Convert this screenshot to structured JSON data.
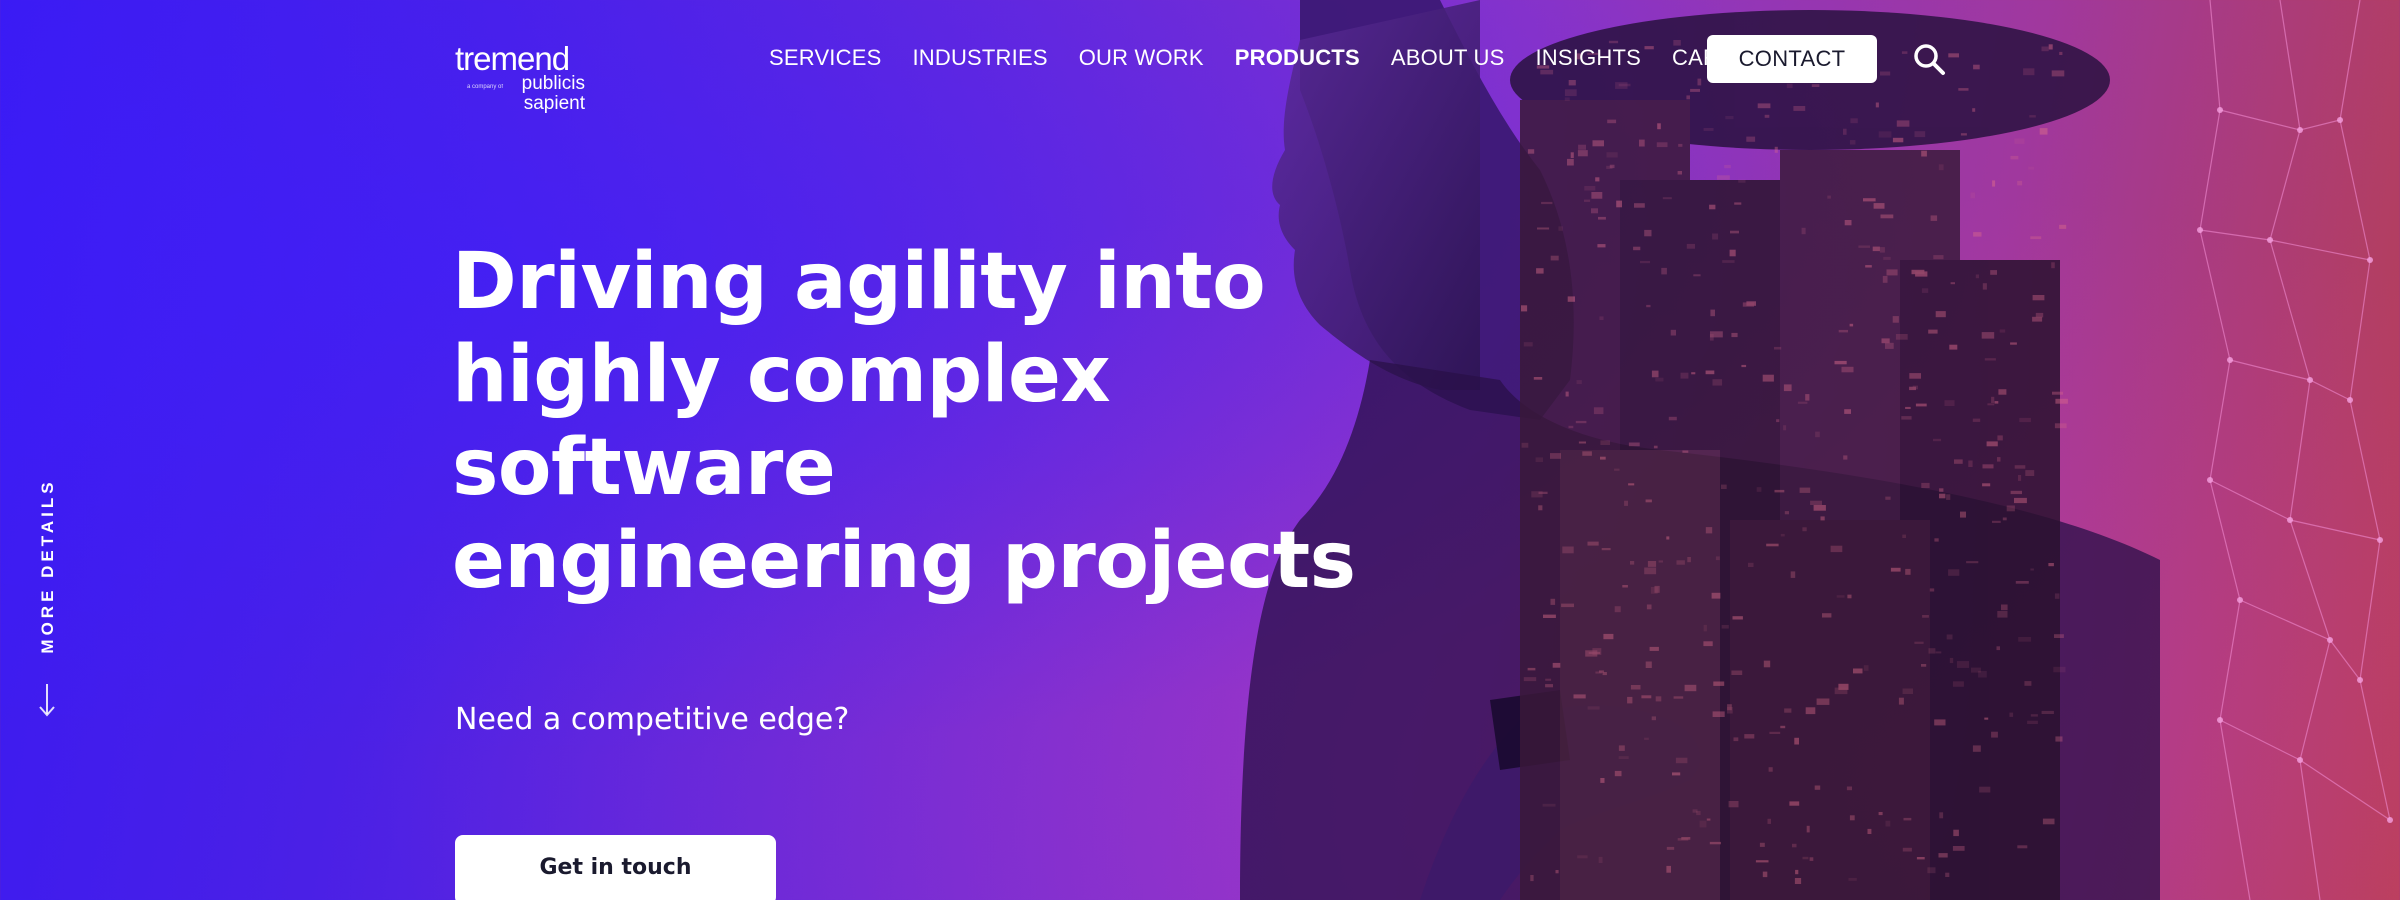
{
  "logo": {
    "brand": "tremend",
    "tiny": "a company of",
    "sub_line1": "publicis",
    "sub_line2": "sapient"
  },
  "nav": {
    "items": [
      {
        "label": "SERVICES"
      },
      {
        "label": "INDUSTRIES"
      },
      {
        "label": "OUR WORK"
      },
      {
        "label": "PRODUCTS"
      },
      {
        "label": "ABOUT US"
      },
      {
        "label": "INSIGHTS"
      },
      {
        "label": "CAREERS"
      }
    ],
    "contact_label": "CONTACT",
    "search_icon": "search-icon"
  },
  "side": {
    "more_details_label": "MORE DETAILS",
    "arrow_icon": "arrow-down-icon"
  },
  "hero": {
    "headline_lines": [
      "Driving agility into",
      "highly complex",
      "software",
      "engineering projects"
    ],
    "tagline": "Need a competitive edge?",
    "cta_label": "Get in touch"
  },
  "colors": {
    "gradient_start": "#3a1af2",
    "gradient_mid": "#8a34c8",
    "gradient_end": "#b8404f",
    "button_bg": "#ffffff",
    "button_text": "#1a1a2e"
  }
}
